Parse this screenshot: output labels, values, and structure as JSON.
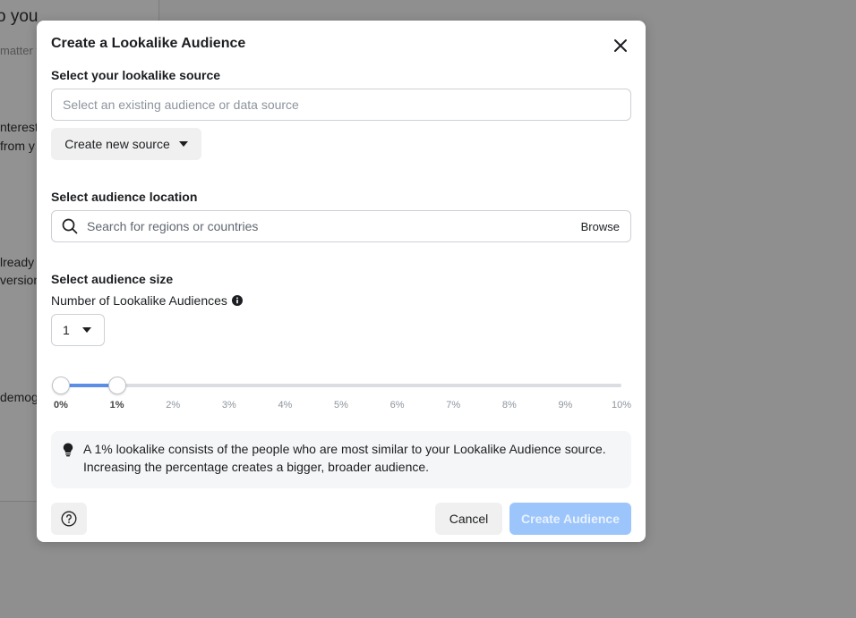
{
  "background": {
    "fragments": [
      "o you",
      "matter t",
      "nterest",
      "from y",
      "lready c",
      "version",
      "demog"
    ]
  },
  "modal": {
    "title": "Create a Lookalike Audience",
    "source": {
      "label": "Select your lookalike source",
      "placeholder": "Select an existing audience or data source",
      "create_button": "Create new source"
    },
    "location": {
      "label": "Select audience location",
      "placeholder": "Search for regions or countries",
      "browse": "Browse"
    },
    "size": {
      "label": "Select audience size",
      "count_label": "Number of Lookalike Audiences",
      "count_value": "1",
      "range_start_percent": 0,
      "range_end_percent": 1,
      "ticks": [
        "0%",
        "1%",
        "2%",
        "3%",
        "4%",
        "5%",
        "6%",
        "7%",
        "8%",
        "9%",
        "10%"
      ]
    },
    "info": "A 1% lookalike consists of the people who are most similar to your Lookalike Audience source. Increasing the percentage creates a bigger, broader audience.",
    "cancel": "Cancel",
    "create": "Create Audience"
  },
  "colors": {
    "accent": "#5b8ee6",
    "create_disabled": "#9cc5fb"
  }
}
